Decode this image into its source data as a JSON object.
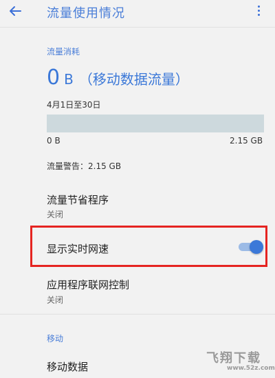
{
  "app_bar": {
    "title": "流量使用情况",
    "back_icon": "arrow-back-icon",
    "more_icon": "more-vert-icon"
  },
  "usage": {
    "section_label": "流量消耗",
    "amount": "0",
    "unit": "B",
    "description": "（移动数据流量）",
    "period": "4月1日至30日",
    "bar_min_label": "0 B",
    "bar_max_label": "2.15 GB",
    "bar_fraction": 0,
    "warning": "流量警告：2.15 GB"
  },
  "settings": {
    "data_saver": {
      "title": "流量节省程序",
      "status": "关闭"
    },
    "realtime_speed": {
      "title": "显示实时网速",
      "toggle_on": true
    },
    "app_network_control": {
      "title": "应用程序联网控制",
      "status": "关闭"
    }
  },
  "mobile": {
    "section_label": "移动",
    "mobile_data": {
      "title": "移动数据"
    }
  },
  "watermark": {
    "brand": "飞翔下载",
    "url": "www.52z.com"
  },
  "colors": {
    "accent": "#3b78d8",
    "highlight": "#e52421",
    "bar_track": "#cdd9dd"
  }
}
